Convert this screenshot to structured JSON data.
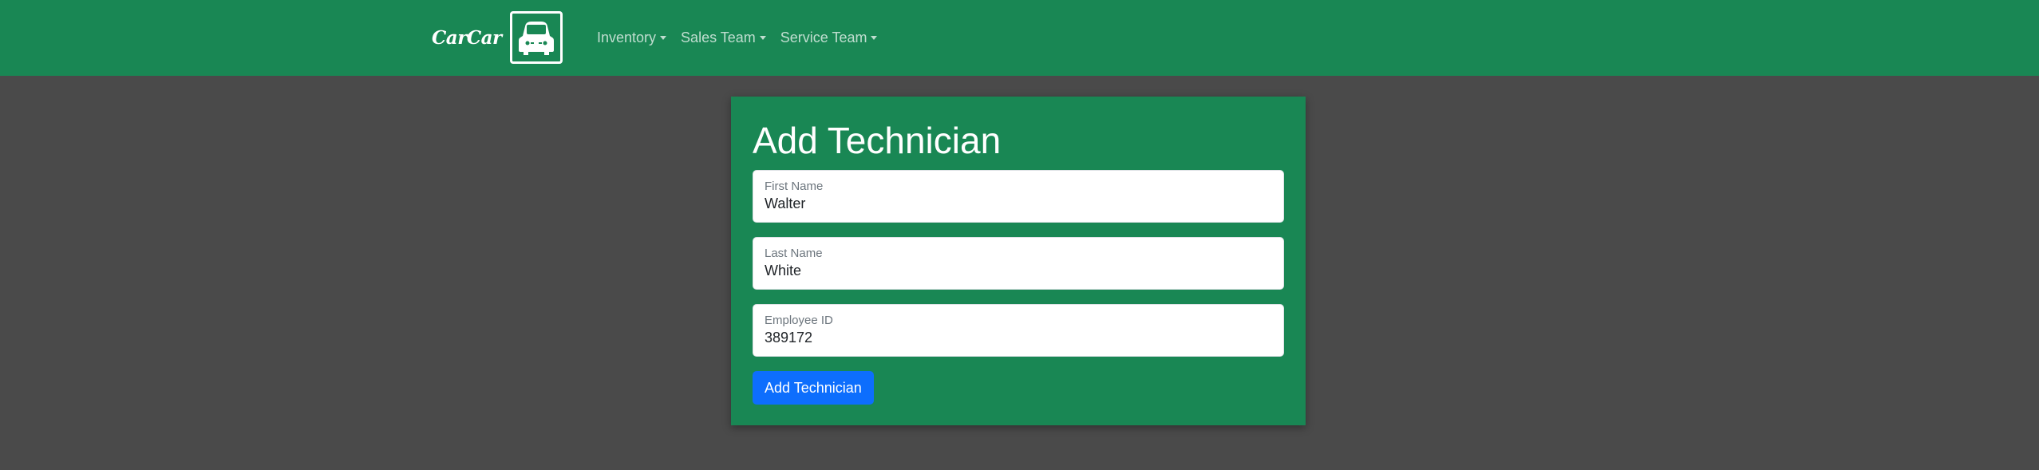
{
  "navbar": {
    "brand": "CarCar",
    "brand_logo_icon": "car-front-icon",
    "items": [
      {
        "label": "Inventory"
      },
      {
        "label": "Sales Team"
      },
      {
        "label": "Service Team"
      }
    ],
    "background_color": "#198754"
  },
  "form": {
    "title": "Add Technician",
    "fields": [
      {
        "label": "First Name",
        "value": "Walter"
      },
      {
        "label": "Last Name",
        "value": "White"
      },
      {
        "label": "Employee ID",
        "value": "389172"
      }
    ],
    "submit_label": "Add Technician",
    "submit_color": "#0d6efd"
  },
  "page": {
    "background_color": "#4a4a4a"
  }
}
